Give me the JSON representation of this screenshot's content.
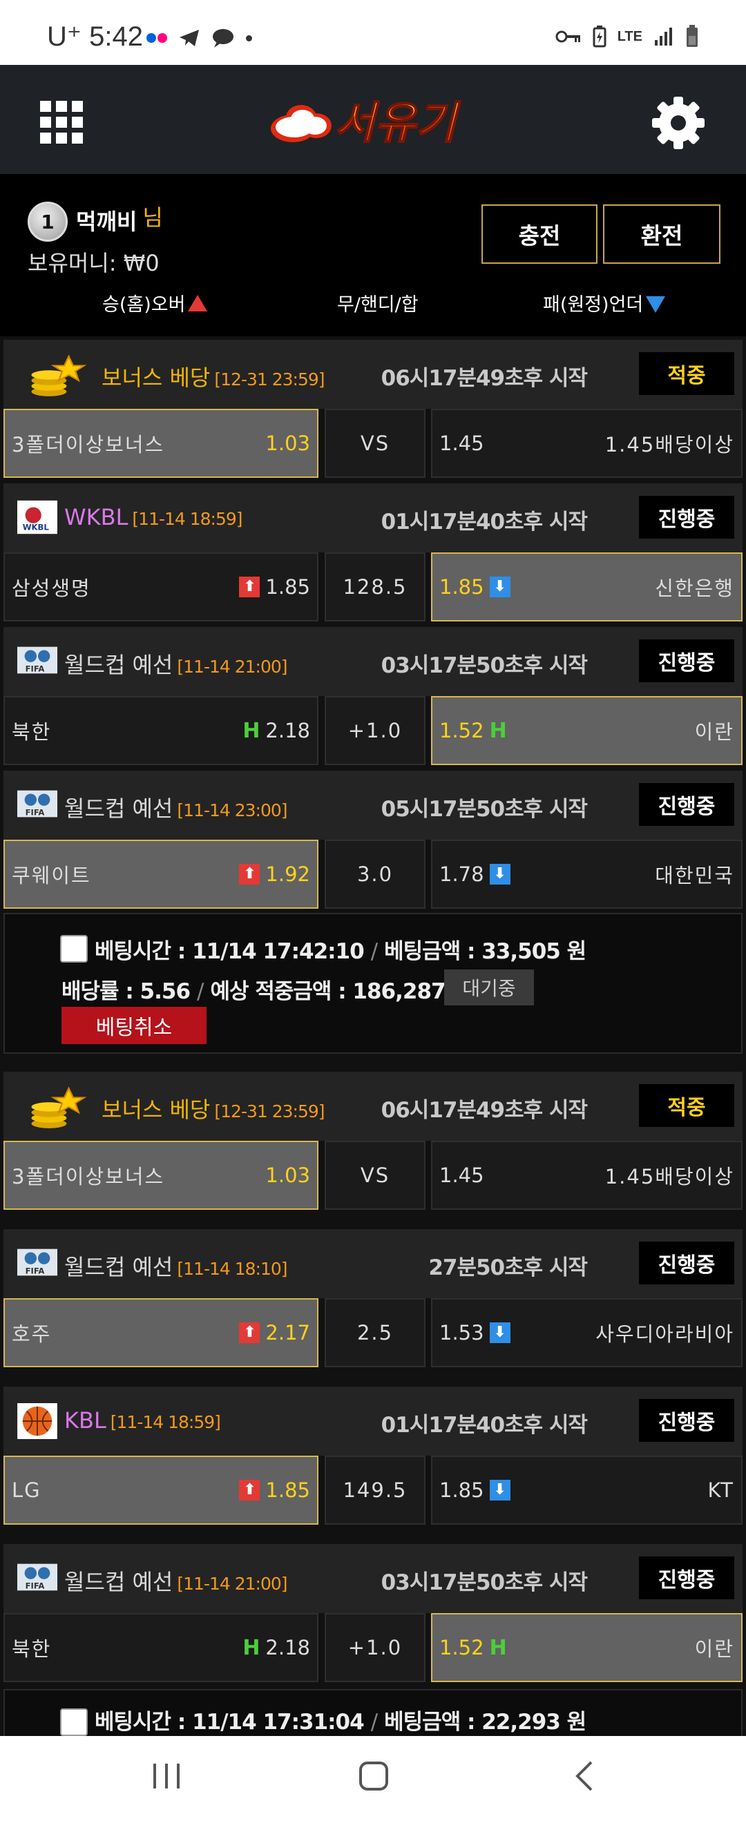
{
  "status_bar": {
    "carrier": "U⁺ 5:42",
    "right_text": "LTE"
  },
  "header": {
    "logo_text": "서유기",
    "menu_icon": "grid-menu-icon",
    "settings_icon": "gear-icon"
  },
  "user": {
    "level": "1",
    "name": "먹깨비",
    "suffix": "님",
    "money_label": "보유머니:",
    "money_value": "₩0",
    "charge_label": "충전",
    "exchange_label": "환전"
  },
  "legend": {
    "home": "승(홈)오버",
    "draw": "무/핸디/합",
    "away": "패(원정)언더"
  },
  "games": [
    {
      "league": "보너스 베당",
      "date": "[12-31 23:59]",
      "time": "06시17분49초후 시작",
      "badge": "적중",
      "icon": "coins-star-icon",
      "home": "3폴더이상보너스",
      "home_odd": "1.03",
      "mid": "VS",
      "away_odd": "1.45",
      "away": "1.45배당이상"
    },
    {
      "league": "WKBL",
      "date": "[11-14 18:59]",
      "time": "01시17분40초후 시작",
      "badge": "진행중",
      "icon": "wkbl-logo-icon",
      "home": "삼성생명",
      "home_odd": "1.85",
      "mid": "128.5",
      "away_odd": "1.85",
      "away": "신한은행"
    },
    {
      "league": "월드컵 예선",
      "date": "[11-14 21:00]",
      "time": "03시17분50초후 시작",
      "badge": "진행중",
      "icon": "fifa-logo-icon",
      "home": "북한",
      "home_odd": "2.18",
      "mid": "+1.0",
      "away_odd": "1.52",
      "away": "이란"
    },
    {
      "league": "월드컵 예선",
      "date": "[11-14 23:00]",
      "time": "05시17분50초후 시작",
      "badge": "진행중",
      "icon": "fifa-logo-icon",
      "home": "쿠웨이트",
      "home_odd": "1.92",
      "mid": "3.0",
      "away_odd": "1.78",
      "away": "대한민국"
    },
    {
      "league": "보너스 베당",
      "date": "[12-31 23:59]",
      "time": "06시17분49초후 시작",
      "badge": "적중",
      "icon": "coins-star-icon",
      "home": "3폴더이상보너스",
      "home_odd": "1.03",
      "mid": "VS",
      "away_odd": "1.45",
      "away": "1.45배당이상"
    },
    {
      "league": "월드컵 예선",
      "date": "[11-14 18:10]",
      "time": "27분50초후 시작",
      "badge": "진행중",
      "icon": "fifa-logo-icon",
      "home": "호주",
      "home_odd": "2.17",
      "mid": "2.5",
      "away_odd": "1.53",
      "away": "사우디아라비아"
    },
    {
      "league": "KBL",
      "date": "[11-14 18:59]",
      "time": "01시17분40초후 시작",
      "badge": "진행중",
      "icon": "basketball-icon",
      "home": "LG",
      "home_odd": "1.85",
      "mid": "149.5",
      "away_odd": "1.85",
      "away": "KT"
    },
    {
      "league": "월드컵 예선",
      "date": "[11-14 21:00]",
      "time": "03시17분50초후 시작",
      "badge": "진행중",
      "icon": "fifa-logo-icon",
      "home": "북한",
      "home_odd": "2.18",
      "mid": "+1.0",
      "away_odd": "1.52",
      "away": "이란"
    }
  ],
  "bets": [
    {
      "time_label": "베팅시간 :",
      "time_value": "11/14 17:42:10",
      "amount_label": "베팅금액 :",
      "amount_value": "33,505 원",
      "rate_label": "배당률 :",
      "rate_value": "5.56",
      "expected_label": "예상 적중금액 :",
      "expected_value": "186,287 원",
      "status": "대기중",
      "cancel_label": "베팅취소"
    },
    {
      "time_label": "베팅시간 :",
      "time_value": "11/14 17:31:04",
      "amount_label": "베팅금액 :",
      "amount_value": "22,293 원"
    }
  ],
  "colors": {
    "accent_gold": "#ffd21a",
    "date_orange": "#f29a1a",
    "up_red": "#e53935",
    "down_blue": "#2f8ee6",
    "selected_border": "#d8b84a"
  }
}
